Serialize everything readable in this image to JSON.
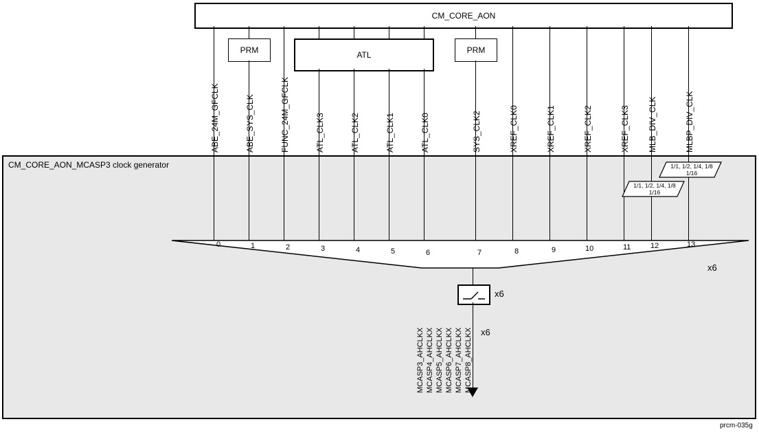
{
  "top_box": "CM_CORE_AON",
  "prm": "PRM",
  "atl": "ATL",
  "gray_title": "CM_CORE_AON_MCASP3 clock generator",
  "sig": [
    "ABE_24M_GFCLK",
    "ABE_SYS_CLK",
    "FUNC_24M_GFCLK",
    "ATL_CLK3",
    "ATL_CLK2",
    "ATL_CLK1",
    "ATL_CLK0",
    "SYS_CLK2",
    "XREF_CLK0",
    "XREF_CLK1",
    "XREF_CLK2",
    "XREF_CLK3",
    "MLB_DIV_CLK",
    "MLBP_DIV_CLK"
  ],
  "idx": [
    "0",
    "1",
    "2",
    "3",
    "4",
    "5",
    "6",
    "7",
    "8",
    "9",
    "10",
    "11",
    "12",
    "13"
  ],
  "div": {
    "l1": "1/1, 1/2, 1/4, 1/8",
    "l2": "1/16"
  },
  "x6": "x6",
  "out": [
    "MCASP3_AHCLKX",
    "MCASP4_AHCLKX",
    "MCASP5_AHCLKX",
    "MCASP6_AHCLKX",
    "MCASP7_AHCLKX",
    "MCASP8_AHCLKX"
  ],
  "figid": "prcm-035g"
}
